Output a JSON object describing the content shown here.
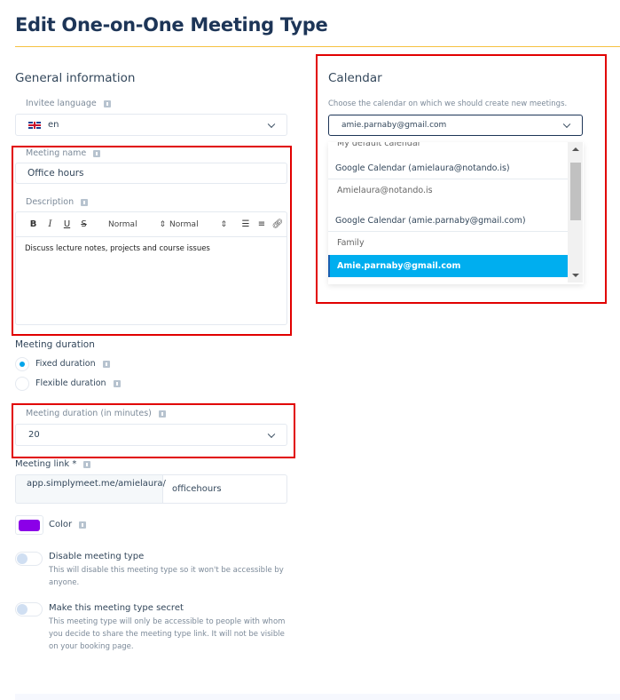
{
  "page": {
    "title": "Edit One-on-One Meeting Type",
    "accent_color": "#f5c242"
  },
  "general": {
    "section_title": "General information",
    "invitee_language": {
      "label": "Invitee language",
      "value": "en",
      "flag": "uk-flag-icon"
    },
    "meeting_name": {
      "label": "Meeting name",
      "value": "Office hours"
    },
    "description": {
      "label": "Description",
      "toolbar": {
        "bold": "B",
        "italic": "I",
        "underline": "U",
        "strike": "S",
        "font_select": "Normal",
        "size_select": "Normal",
        "ordered_list": "ordered-list-icon",
        "bullet_list": "bullet-list-icon",
        "link": "link-icon"
      },
      "value": "Discuss lecture notes, projects and course issues"
    },
    "meeting_duration": {
      "label": "Meeting duration",
      "options": [
        {
          "label": "Fixed duration",
          "checked": true
        },
        {
          "label": "Flexible duration",
          "checked": false
        }
      ]
    },
    "duration_minutes": {
      "label": "Meeting duration (in minutes)",
      "value": "20"
    },
    "meeting_link": {
      "label": "Meeting link *",
      "prefix": "app.simplymeet.me/amielaura/",
      "value": "officehours"
    },
    "color": {
      "label": "Color",
      "value": "#8b00e8"
    },
    "disable": {
      "title": "Disable meeting type",
      "description": "This will disable this meeting type so it won't be accessible by anyone.",
      "on": false
    },
    "secret": {
      "title": "Make this meeting type secret",
      "description": "This meeting type will only be accessible to people with whom you decide to share the meeting type link. It will not be visible on your booking page.",
      "on": false
    }
  },
  "calendar": {
    "section_title": "Calendar",
    "hint": "Choose the calendar on which we should create new meetings.",
    "selected": "amie.parnaby@gmail.com",
    "dropdown": {
      "items": [
        {
          "label": "My default calendar",
          "type": "option"
        },
        {
          "label": "Google Calendar (amielaura@notando.is)",
          "type": "group"
        },
        {
          "label": "Amielaura@notando.is",
          "type": "option"
        },
        {
          "label": "Google Calendar (amie.parnaby@gmail.com)",
          "type": "group"
        },
        {
          "label": "Family",
          "type": "option"
        },
        {
          "label": "Amie.parnaby@gmail.com",
          "type": "option",
          "selected": true
        }
      ]
    }
  }
}
